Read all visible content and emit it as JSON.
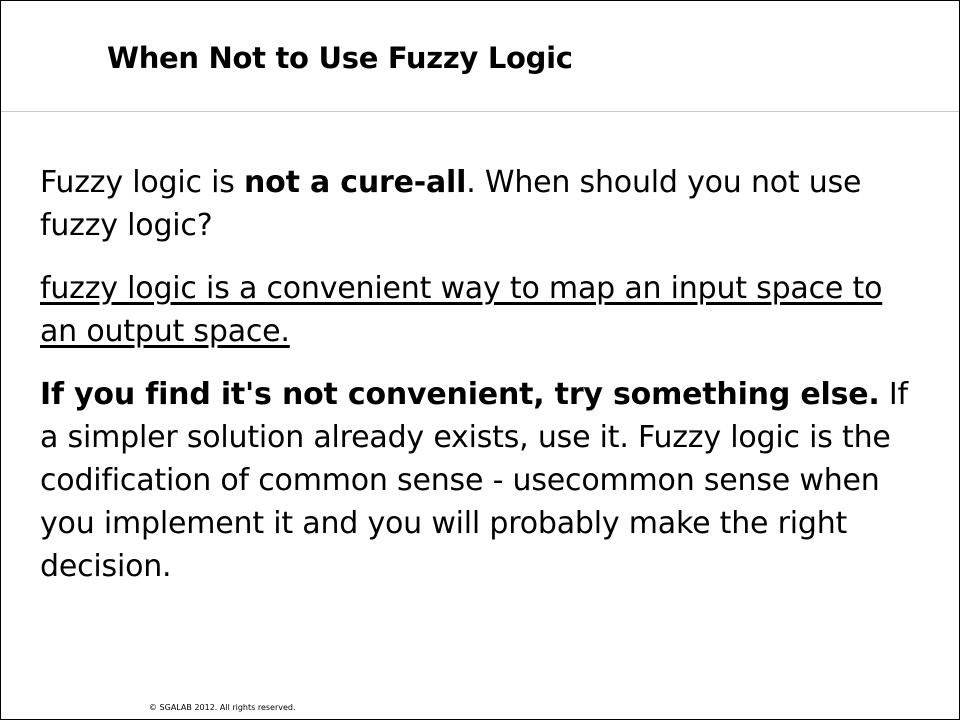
{
  "slide": {
    "title": "When Not to Use Fuzzy Logic",
    "paragraph1": {
      "lead": "Fuzzy logic is ",
      "bold": "not a cure-all",
      "rest": ". When should you not use fuzzy logic?"
    },
    "paragraph2": {
      "text": "fuzzy logic is a convenient way to map an input space to an output space."
    },
    "paragraph3": {
      "bold": "If you find  it's not convenient, try something else.",
      "rest": " If a simpler solution already exists, use it. Fuzzy logic is the codification  of common sense - usecommon sense when you implement it and you will probably make the right decision."
    },
    "footer": "© SGALAB 2012. All rights reserved."
  }
}
